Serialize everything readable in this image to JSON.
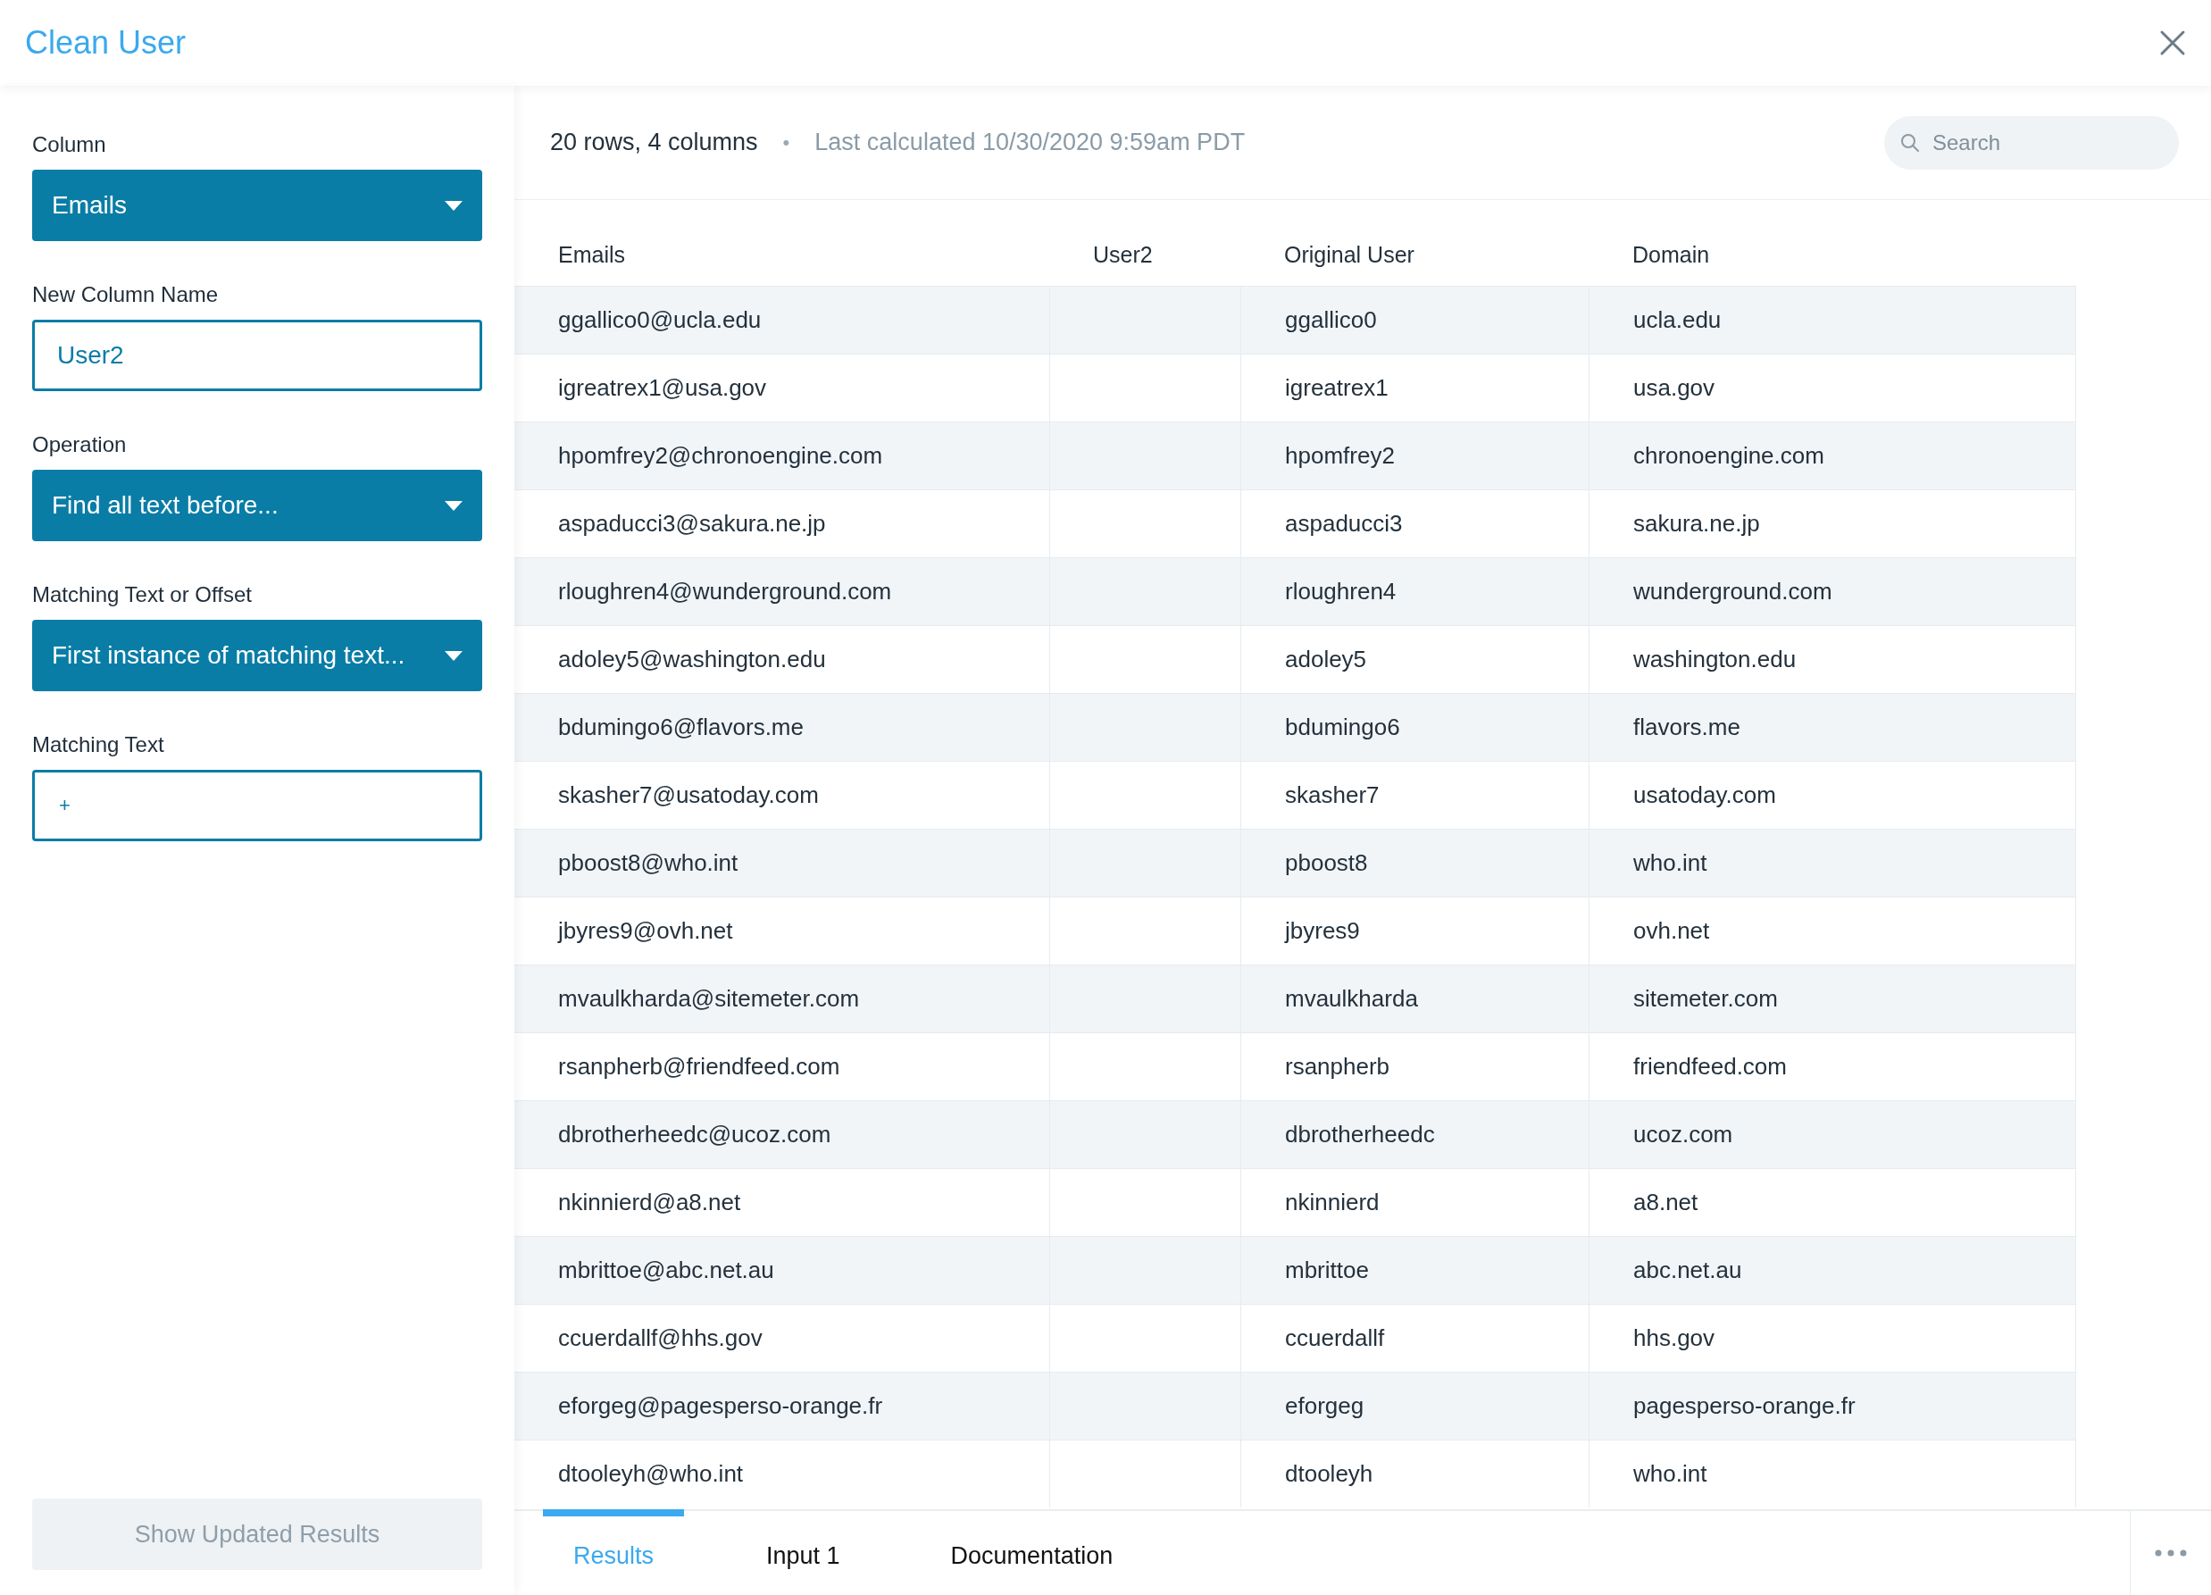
{
  "window": {
    "title": "Clean User"
  },
  "sidebar": {
    "fields": [
      {
        "kind": "select",
        "label": "Column",
        "value": "Emails"
      },
      {
        "kind": "input",
        "label": "New Column Name",
        "value": "User2"
      },
      {
        "kind": "select",
        "label": "Operation",
        "value": "Find all text before..."
      },
      {
        "kind": "select",
        "label": "Matching Text or Offset",
        "value": "First instance of matching text..."
      },
      {
        "kind": "input",
        "label": "Matching Text",
        "value": "+"
      }
    ],
    "submit": {
      "label": "Show Updated Results",
      "disabled": true
    }
  },
  "summary": {
    "counts": "20 rows, 4 columns",
    "separator": "•",
    "calculated": "Last calculated 10/30/2020 9:59am PDT"
  },
  "search": {
    "placeholder": "Search"
  },
  "table": {
    "columns": [
      "Emails",
      "User2",
      "Original User",
      "Domain"
    ],
    "rows": [
      [
        "ggallico0@ucla.edu",
        null,
        "ggallico0",
        "ucla.edu"
      ],
      [
        "igreatrex1@usa.gov",
        null,
        "igreatrex1",
        "usa.gov"
      ],
      [
        "hpomfrey2@chronoengine.com",
        null,
        "hpomfrey2",
        "chronoengine.com"
      ],
      [
        "aspaducci3@sakura.ne.jp",
        null,
        "aspaducci3",
        "sakura.ne.jp"
      ],
      [
        "rloughren4@wunderground.com",
        null,
        "rloughren4",
        "wunderground.com"
      ],
      [
        "adoley5@washington.edu",
        null,
        "adoley5",
        "washington.edu"
      ],
      [
        "bdumingo6@flavors.me",
        null,
        "bdumingo6",
        "flavors.me"
      ],
      [
        "skasher7@usatoday.com",
        null,
        "skasher7",
        "usatoday.com"
      ],
      [
        "pboost8@who.int",
        null,
        "pboost8",
        "who.int"
      ],
      [
        "jbyres9@ovh.net",
        null,
        "jbyres9",
        "ovh.net"
      ],
      [
        "mvaulkharda@sitemeter.com",
        null,
        "mvaulkharda",
        "sitemeter.com"
      ],
      [
        "rsanpherb@friendfeed.com",
        null,
        "rsanpherb",
        "friendfeed.com"
      ],
      [
        "dbrotherheedc@ucoz.com",
        null,
        "dbrotherheedc",
        "ucoz.com"
      ],
      [
        "nkinnierd@a8.net",
        null,
        "nkinnierd",
        "a8.net"
      ],
      [
        "mbrittoe@abc.net.au",
        null,
        "mbrittoe",
        "abc.net.au"
      ],
      [
        "ccuerdallf@hhs.gov",
        null,
        "ccuerdallf",
        "hhs.gov"
      ],
      [
        "eforgeg@pagesperso-orange.fr",
        null,
        "eforgeg",
        "pagesperso-orange.fr"
      ],
      [
        "dtooleyh@who.int",
        null,
        "dtooleyh",
        "who.int"
      ]
    ]
  },
  "tabs": [
    {
      "label": "Results",
      "selected": true
    },
    {
      "label": "Input 1",
      "selected": false
    },
    {
      "label": "Documentation",
      "selected": false
    }
  ]
}
